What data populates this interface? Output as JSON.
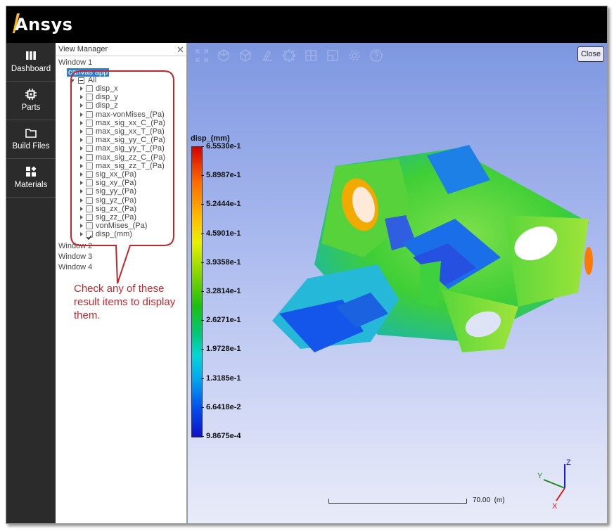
{
  "app": {
    "brand": "Ansys"
  },
  "sidebar": {
    "items": [
      {
        "label": "Dashboard",
        "icon": "bar-chart-icon"
      },
      {
        "label": "Parts",
        "icon": "chip-icon"
      },
      {
        "label": "Build Files",
        "icon": "folder-icon"
      },
      {
        "label": "Materials",
        "icon": "blocks-icon"
      }
    ]
  },
  "view_manager": {
    "title": "View Manager",
    "close_glyph": "✕",
    "window1": "Window 1",
    "canvas_app": "canvas app",
    "all": "All",
    "results": [
      {
        "label": "disp_x",
        "checked": false
      },
      {
        "label": "disp_y",
        "checked": false
      },
      {
        "label": "disp_z",
        "checked": false
      },
      {
        "label": "max-vonMises_(Pa)",
        "checked": false
      },
      {
        "label": "max_sig_xx_C_(Pa)",
        "checked": false
      },
      {
        "label": "max_sig_xx_T_(Pa)",
        "checked": false
      },
      {
        "label": "max_sig_yy_C_(Pa)",
        "checked": false
      },
      {
        "label": "max_sig_yy_T_(Pa)",
        "checked": false
      },
      {
        "label": "max_sig_zz_C_(Pa)",
        "checked": false
      },
      {
        "label": "max_sig_zz_T_(Pa)",
        "checked": false
      },
      {
        "label": "sig_xx_(Pa)",
        "checked": false
      },
      {
        "label": "sig_xy_(Pa)",
        "checked": false
      },
      {
        "label": "sig_yy_(Pa)",
        "checked": false
      },
      {
        "label": "sig_yz_(Pa)",
        "checked": false
      },
      {
        "label": "sig_zx_(Pa)",
        "checked": false
      },
      {
        "label": "sig_zz_(Pa)",
        "checked": false
      },
      {
        "label": "vonMises_(Pa)",
        "checked": false
      },
      {
        "label": "disp_(mm)",
        "checked": true
      }
    ],
    "other_windows": [
      "Window 2",
      "Window 3",
      "Window 4"
    ]
  },
  "annotation": {
    "text": "Check any of these result items to display them.",
    "color": "#c0272d"
  },
  "viewport": {
    "close_label": "Close",
    "toolbar_icons": [
      "fit-view-icon",
      "iso-view-icon",
      "box-view-icon",
      "annotate-icon",
      "spinner-icon",
      "grid-layout-icon",
      "window-layout-icon",
      "settings-icon",
      "help-icon"
    ],
    "legend": {
      "title": "disp_(mm)",
      "ticks": [
        "6.5530e-1",
        "5.8987e-1",
        "5.2444e-1",
        "4.5901e-1",
        "3.9358e-1",
        "3.2814e-1",
        "2.6271e-1",
        "1.9728e-1",
        "1.3185e-1",
        "6.6418e-2",
        "9.8675e-4"
      ]
    },
    "scale_bar": {
      "value": "70.00",
      "unit": "(m)"
    },
    "axes": {
      "x": "X",
      "y": "Y",
      "z": "Z"
    }
  }
}
